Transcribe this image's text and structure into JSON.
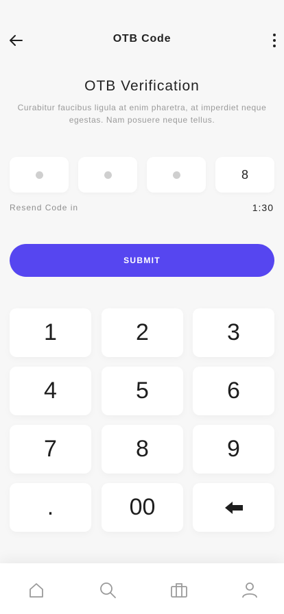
{
  "header": {
    "title": "OTB Code",
    "back_icon": "arrow-left-icon",
    "more_icon": "more-vertical-icon"
  },
  "verification": {
    "title": "OTB Verification",
    "description": "Curabitur faucibus ligula at enim pharetra, at imperdiet neque egestas. Nam posuere neque tellus."
  },
  "code": {
    "boxes": [
      {
        "filled": false,
        "value": ""
      },
      {
        "filled": false,
        "value": ""
      },
      {
        "filled": false,
        "value": ""
      },
      {
        "filled": true,
        "value": "8"
      }
    ]
  },
  "resend": {
    "label": "Resend Code in",
    "timer": "1:30"
  },
  "submit": {
    "label": "SUBMIT",
    "color": "#5646f0"
  },
  "keypad": {
    "keys": [
      "1",
      "2",
      "3",
      "4",
      "5",
      "6",
      "7",
      "8",
      "9",
      ".",
      "00",
      "backspace"
    ]
  },
  "bottom_nav": {
    "items": [
      {
        "icon": "home-icon"
      },
      {
        "icon": "search-icon"
      },
      {
        "icon": "briefcase-icon"
      },
      {
        "icon": "user-icon"
      }
    ]
  }
}
